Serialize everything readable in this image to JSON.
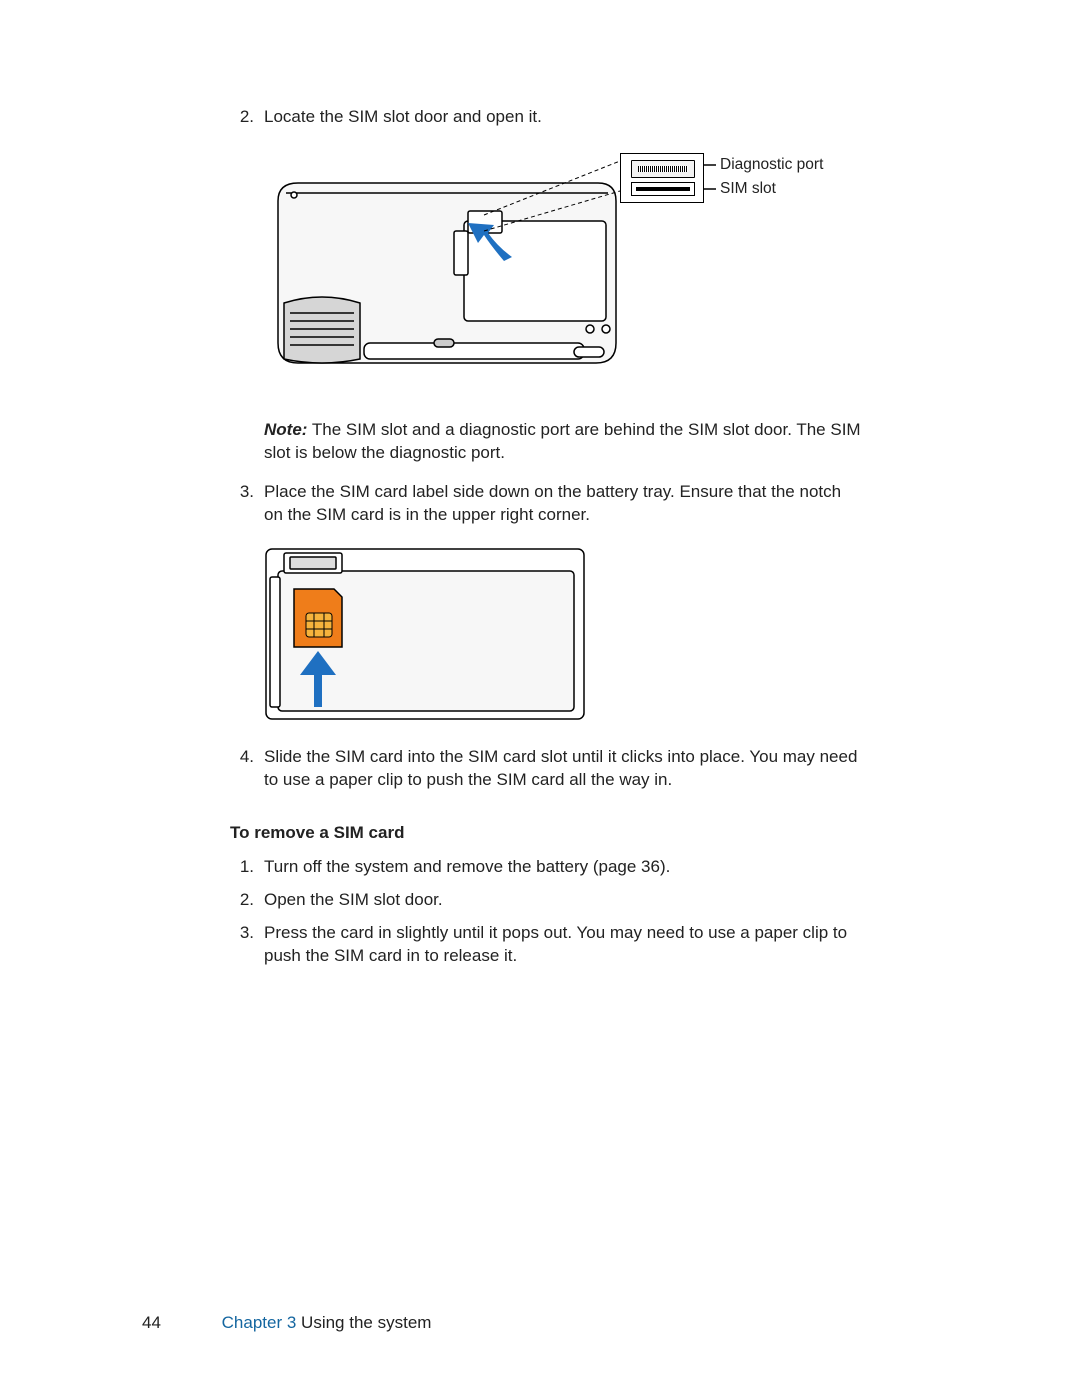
{
  "steps_a": {
    "s2_num": "2.",
    "s2_text": "Locate the SIM slot door and open it.",
    "s3_num": "3.",
    "s3_text": "Place the SIM card label side down on the battery tray. Ensure that the notch on the SIM card is in the upper right corner.",
    "s4_num": "4.",
    "s4_text": "Slide the SIM card into the SIM card slot until it clicks into place. You may need to use a paper clip to push the SIM card all the way in."
  },
  "callouts": {
    "diag": "Diagnostic port",
    "sim": "SIM slot"
  },
  "note_label": "Note:",
  "note_text": " The SIM slot and a diagnostic port are behind the SIM slot door. The SIM slot is below the diagnostic port.",
  "heading_remove": "To remove a SIM card",
  "steps_b": {
    "s1_num": "1.",
    "s1_text": "Turn off the system and remove the battery (page 36).",
    "s2_num": "2.",
    "s2_text": "Open the SIM slot door.",
    "s3_num": "3.",
    "s3_text": "Press the card in slightly until it pops out. You may need to use a paper clip to push the SIM card in to release it."
  },
  "footer": {
    "page": "44",
    "chapter": "Chapter 3",
    "title": "  Using the system"
  }
}
